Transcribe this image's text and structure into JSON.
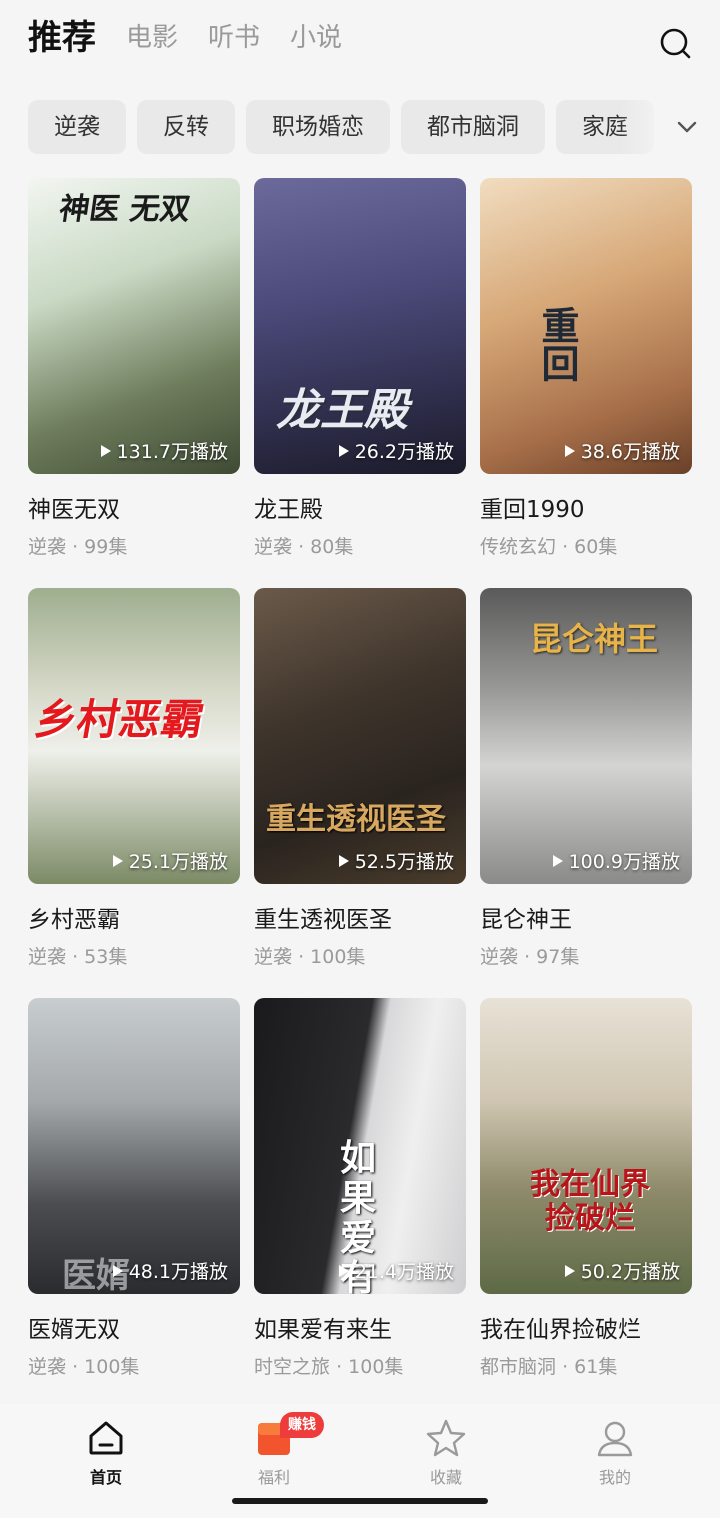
{
  "header": {
    "tabs": [
      "推荐",
      "电影",
      "听书",
      "小说"
    ],
    "search_icon": "search-icon"
  },
  "categories": [
    "逆袭",
    "反转",
    "职场婚恋",
    "都市脑洞",
    "家庭"
  ],
  "dramas": [
    {
      "title": "神医无双",
      "genre": "逆袭",
      "episodes": "99集",
      "plays": "131.7万播放",
      "poster_text": "神医 无双"
    },
    {
      "title": "龙王殿",
      "genre": "逆袭",
      "episodes": "80集",
      "plays": "26.2万播放",
      "poster_text": "龙王殿"
    },
    {
      "title": "重回1990",
      "genre": "传统玄幻",
      "episodes": "60集",
      "plays": "38.6万播放",
      "poster_text": "重回"
    },
    {
      "title": "乡村恶霸",
      "genre": "逆袭",
      "episodes": "53集",
      "plays": "25.1万播放",
      "poster_text": "乡村恶霸"
    },
    {
      "title": "重生透视医圣",
      "genre": "逆袭",
      "episodes": "100集",
      "plays": "52.5万播放",
      "poster_text": "重生透视医圣"
    },
    {
      "title": "昆仑神王",
      "genre": "逆袭",
      "episodes": "97集",
      "plays": "100.9万播放",
      "poster_text": "昆仑神王"
    },
    {
      "title": "医婿无双",
      "genre": "逆袭",
      "episodes": "100集",
      "plays": "48.1万播放",
      "poster_text": "医婿"
    },
    {
      "title": "如果爱有来生",
      "genre": "时空之旅",
      "episodes": "100集",
      "plays": "21.4万播放",
      "poster_text": "如果爱有来"
    },
    {
      "title": "我在仙界捡破烂",
      "genre": "都市脑洞",
      "episodes": "61集",
      "plays": "50.2万播放",
      "poster_text": "我在仙界 捡破烂"
    }
  ],
  "meta_separator": "·",
  "bottom_nav": {
    "items": [
      {
        "label": "首页",
        "icon": "home-icon",
        "active": true
      },
      {
        "label": "福利",
        "icon": "gift-icon",
        "badge": "赚钱"
      },
      {
        "label": "收藏",
        "icon": "star-icon"
      },
      {
        "label": "我的",
        "icon": "user-icon"
      }
    ]
  },
  "colors": {
    "accent": "#ee3b3b",
    "active_text": "#111111",
    "muted_text": "#9a9a9a"
  }
}
